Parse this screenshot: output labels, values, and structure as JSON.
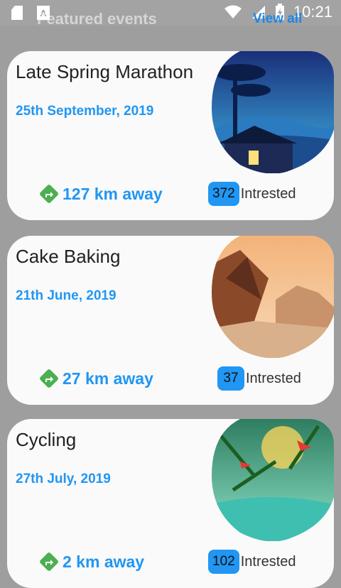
{
  "status_bar": {
    "time": "10:21",
    "icons": [
      "sd-card-icon",
      "text-a-icon",
      "wifi-icon",
      "signal-icon",
      "battery-charging-icon"
    ]
  },
  "header": {
    "title": "Featured events",
    "link": "View all"
  },
  "events": [
    {
      "title": "Late Spring Marathon",
      "date": "25th September, 2019",
      "distance": "127 km away",
      "count": "372",
      "interested_label": "Intrested",
      "image": "night-house-illustration"
    },
    {
      "title": "Cake Baking",
      "date": "21th June, 2019",
      "distance": "27 km away",
      "count": "37",
      "interested_label": "Intrested",
      "image": "mountain-canyon-illustration"
    },
    {
      "title": "Cycling",
      "date": "27th July, 2019",
      "distance": "2 km away",
      "count": "102",
      "interested_label": "Intrested",
      "image": "forest-lake-illustration"
    }
  ]
}
